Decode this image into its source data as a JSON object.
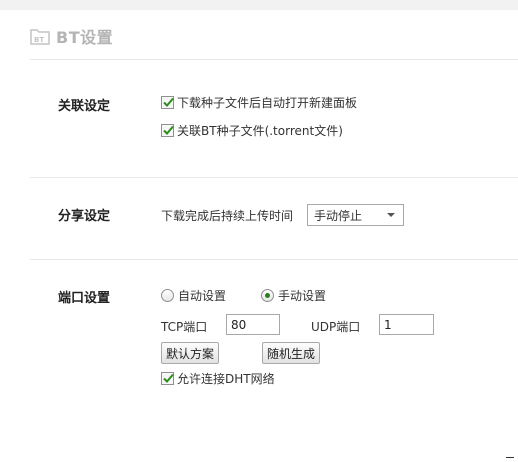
{
  "header": {
    "title": "BT设置",
    "icon": "bt-folder-icon"
  },
  "association": {
    "label": "关联设定",
    "auto_open_new_panel": {
      "label": "下载种子文件后自动打开新建面板",
      "checked": true
    },
    "associate_torrent": {
      "label": "关联BT种子文件(.torrent文件)",
      "checked": true
    }
  },
  "sharing": {
    "label": "分享设定",
    "upload_after_complete_label": "下载完成后持续上传时间",
    "upload_after_complete_value": "手动停止"
  },
  "ports": {
    "label": "端口设置",
    "mode_auto": {
      "label": "自动设置",
      "selected": false
    },
    "mode_manual": {
      "label": "手动设置",
      "selected": true
    },
    "tcp_label": "TCP端口",
    "tcp_value": "80",
    "udp_label": "UDP端口",
    "udp_value": "1",
    "default_button": "默认方案",
    "random_button": "随机生成",
    "allow_dht": {
      "label": "允许连接DHT网络",
      "checked": true
    }
  }
}
